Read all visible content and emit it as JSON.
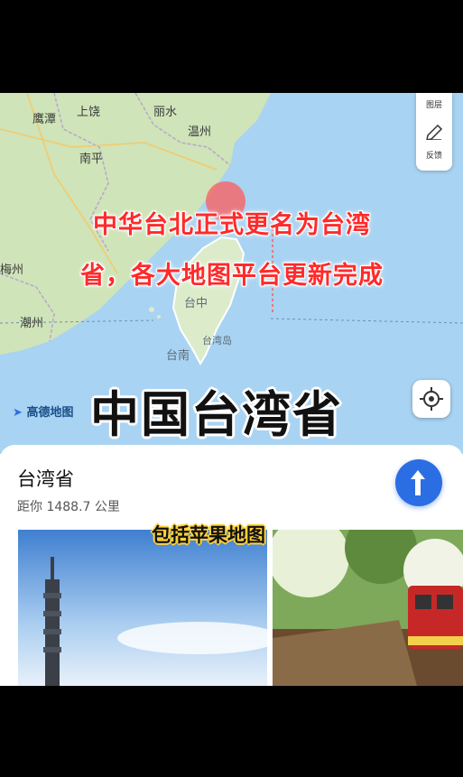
{
  "map": {
    "labels": [
      "鹰潭",
      "上饶",
      "丽水",
      "温州",
      "南平",
      "梅州",
      "潮州",
      "台中",
      "台湾岛",
      "台南"
    ],
    "brand": "高德地图",
    "toolbar": {
      "layers_label": "图层",
      "feedback_label": "反馈"
    }
  },
  "overlay": {
    "headline_line1": "中华台北正式更名为台湾",
    "headline_line2": "省，各大地图平台更新完成",
    "big_title": "中国台湾省"
  },
  "place_card": {
    "name": "台湾省",
    "distance": "距你 1488.7 公里",
    "photo_caption": "包括苹果地图"
  },
  "colors": {
    "sea": "#a9d3f2",
    "land": "#cfe4b8",
    "headline": "#ff2a2a",
    "nav_button": "#2b6ee3",
    "caption_bg": "#ffd23a"
  },
  "icons": [
    "layers-icon",
    "feedback-edit-icon",
    "locate-icon",
    "navigation-arrow-icon",
    "location-pin-icon"
  ]
}
